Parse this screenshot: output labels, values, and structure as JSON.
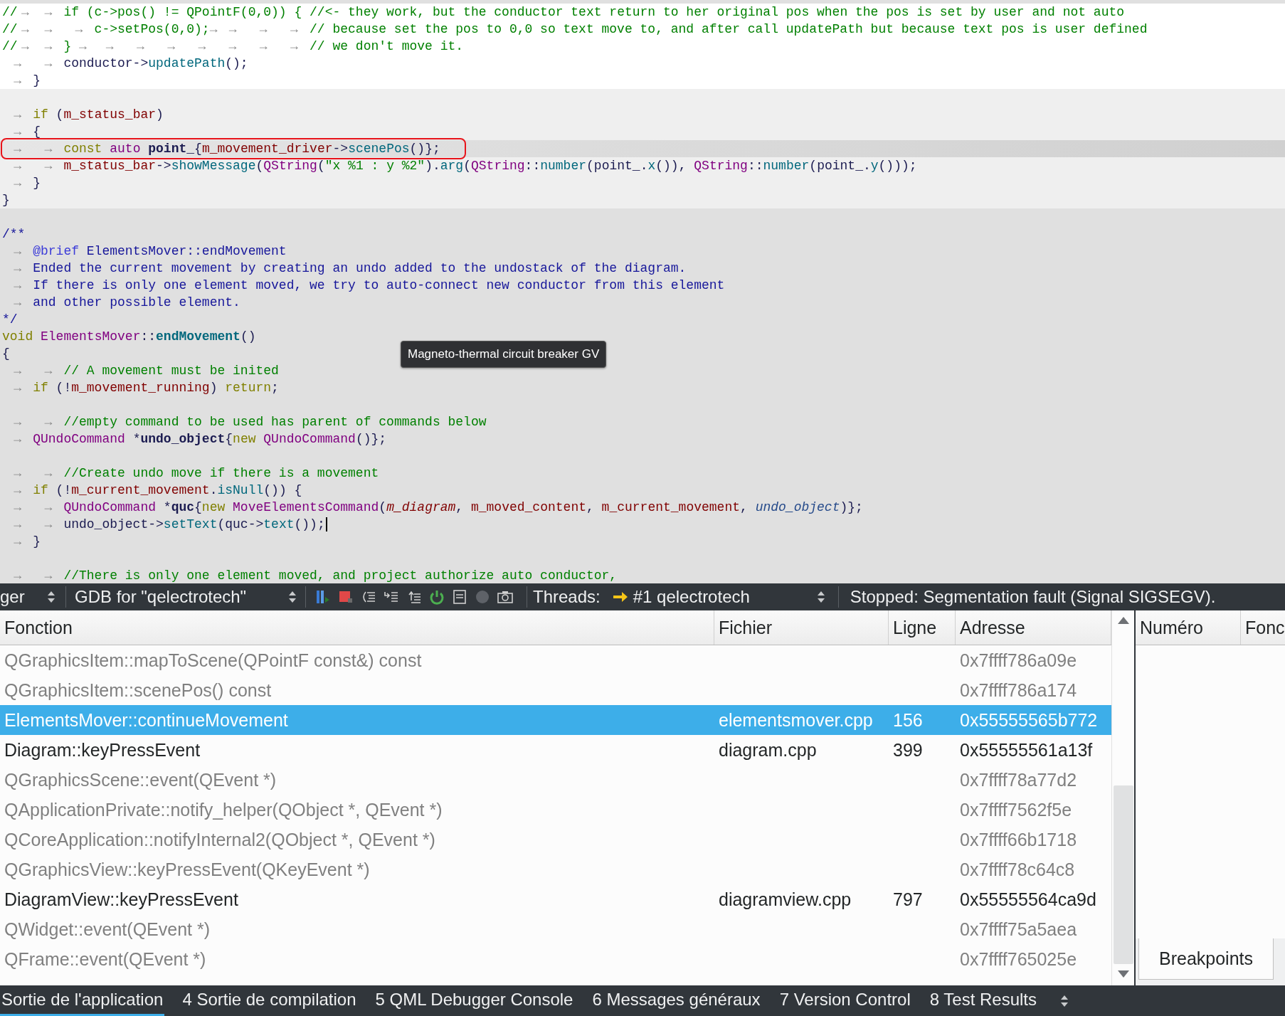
{
  "editor": {
    "blocks": [
      {
        "color": "#ffffff",
        "lines": [
          {
            "tokens": [
              {
                "kind": "comment",
                "text": "//"
              },
              {
                "kind": "tab",
                "text": "→ →"
              },
              {
                "kind": "comment",
                "text": "if (c->pos() != QPointF(0,0)) { //<- they work, but the conductor text return to her original pos when the pos is set by user and not auto"
              }
            ]
          },
          {
            "tokens": [
              {
                "kind": "comment",
                "text": "//"
              },
              {
                "kind": "tab",
                "text": "→ → →"
              },
              {
                "kind": "comment",
                "text": "c->setPos(0,0);"
              },
              {
                "kind": "tab",
                "text": "→ → → →"
              },
              {
                "kind": "comment",
                "text": "// because set the pos to 0,0 so text move to, and after call updatePath but because text pos is user defined"
              }
            ]
          },
          {
            "tokens": [
              {
                "kind": "comment",
                "text": "//"
              },
              {
                "kind": "tab",
                "text": "→ →"
              },
              {
                "kind": "comment",
                "text": "}"
              },
              {
                "kind": "tab",
                "text": "→ → → → → → → →"
              },
              {
                "kind": "comment",
                "text": "// we don't move it."
              }
            ]
          },
          {
            "tokens": [
              {
                "kind": "tab",
                "text": "→ →"
              },
              {
                "kind": "plain",
                "text": "conductor->"
              },
              {
                "kind": "func",
                "text": "updatePath"
              },
              {
                "kind": "plain",
                "text": "();"
              }
            ]
          },
          {
            "tokens": [
              {
                "kind": "tab",
                "text": "→"
              },
              {
                "kind": "plain",
                "text": "}"
              }
            ]
          }
        ]
      },
      {
        "color": "#efefef",
        "lines": [
          {
            "spaced": true,
            "tokens": [
              {
                "kind": "tab",
                "text": "→"
              },
              {
                "kind": "keyword",
                "text": "if"
              },
              {
                "kind": "plain",
                "text": " ("
              },
              {
                "kind": "member",
                "text": "m_status_bar"
              },
              {
                "kind": "plain",
                "text": ")"
              }
            ]
          },
          {
            "tokens": [
              {
                "kind": "tab",
                "text": "→"
              },
              {
                "kind": "plain",
                "text": "{"
              }
            ]
          },
          {
            "current": true,
            "circled": true,
            "tokens": [
              {
                "kind": "tab",
                "text": "→ →"
              },
              {
                "kind": "keyword",
                "text": "const"
              },
              {
                "kind": "type",
                "text": " auto"
              },
              {
                "kind": "decl",
                "text": " point_"
              },
              {
                "kind": "plain",
                "text": "{"
              },
              {
                "kind": "member",
                "text": "m_movement_driver"
              },
              {
                "kind": "plain",
                "text": "->"
              },
              {
                "kind": "func",
                "text": "scenePos"
              },
              {
                "kind": "plain",
                "text": "()};"
              }
            ]
          },
          {
            "tokens": [
              {
                "kind": "tab",
                "text": "→ →"
              },
              {
                "kind": "member",
                "text": "m_status_bar"
              },
              {
                "kind": "plain",
                "text": "->"
              },
              {
                "kind": "func",
                "text": "showMessage"
              },
              {
                "kind": "plain",
                "text": "("
              },
              {
                "kind": "type",
                "text": "QString"
              },
              {
                "kind": "plain",
                "text": "("
              },
              {
                "kind": "string",
                "text": "\"x %1 : y %2\""
              },
              {
                "kind": "plain",
                "text": ")."
              },
              {
                "kind": "func",
                "text": "arg"
              },
              {
                "kind": "plain",
                "text": "("
              },
              {
                "kind": "type",
                "text": "QString"
              },
              {
                "kind": "plain",
                "text": "::"
              },
              {
                "kind": "func",
                "text": "number"
              },
              {
                "kind": "plain",
                "text": "(point_."
              },
              {
                "kind": "func",
                "text": "x"
              },
              {
                "kind": "plain",
                "text": "()), "
              },
              {
                "kind": "type",
                "text": "QString"
              },
              {
                "kind": "plain",
                "text": "::"
              },
              {
                "kind": "func",
                "text": "number"
              },
              {
                "kind": "plain",
                "text": "(point_."
              },
              {
                "kind": "func",
                "text": "y"
              },
              {
                "kind": "plain",
                "text": "()));"
              }
            ]
          },
          {
            "tokens": [
              {
                "kind": "tab",
                "text": "→"
              },
              {
                "kind": "plain",
                "text": "}"
              }
            ]
          },
          {
            "tokens": [
              {
                "kind": "plain",
                "text": "}"
              }
            ]
          }
        ]
      },
      {
        "color": "#e0e0e0",
        "lines": [
          {
            "spaced": true,
            "tokens": [
              {
                "kind": "doc",
                "text": "/**"
              }
            ]
          },
          {
            "tokens": [
              {
                "kind": "tab",
                "text": "→"
              },
              {
                "kind": "doctag",
                "text": "@brief"
              },
              {
                "kind": "doc",
                "text": " ElementsMover::endMovement"
              }
            ]
          },
          {
            "tokens": [
              {
                "kind": "tab",
                "text": "→"
              },
              {
                "kind": "doc",
                "text": "Ended the current movement by creating an undo added to the undostack of the diagram."
              }
            ]
          },
          {
            "tokens": [
              {
                "kind": "tab",
                "text": "→"
              },
              {
                "kind": "doc",
                "text": "If there is only one element moved, we try to auto-connect new conductor from this element"
              }
            ]
          },
          {
            "tokens": [
              {
                "kind": "tab",
                "text": "→"
              },
              {
                "kind": "doc",
                "text": "and other possible element."
              }
            ]
          },
          {
            "tokens": [
              {
                "kind": "doc",
                "text": "*/"
              }
            ]
          },
          {
            "tokens": [
              {
                "kind": "keyword",
                "text": "void"
              },
              {
                "kind": "type",
                "text": " ElementsMover"
              },
              {
                "kind": "plain",
                "text": "::"
              },
              {
                "kind": "declfunc",
                "text": "endMovement"
              },
              {
                "kind": "plain",
                "text": "()"
              }
            ]
          },
          {
            "tokens": [
              {
                "kind": "plain",
                "text": "{"
              }
            ]
          },
          {
            "tokens": [
              {
                "kind": "tab",
                "text": "→ →"
              },
              {
                "kind": "comment",
                "text": "// A movement must be inited"
              }
            ]
          },
          {
            "tokens": [
              {
                "kind": "tab",
                "text": "→"
              },
              {
                "kind": "keyword",
                "text": "if"
              },
              {
                "kind": "plain",
                "text": " (!"
              },
              {
                "kind": "member",
                "text": "m_movement_running"
              },
              {
                "kind": "plain",
                "text": ") "
              },
              {
                "kind": "keyword",
                "text": "return"
              },
              {
                "kind": "plain",
                "text": ";"
              }
            ]
          },
          {
            "spaced": true,
            "tokens": [
              {
                "kind": "tab",
                "text": "→ →"
              },
              {
                "kind": "comment",
                "text": "//empty command to be used has parent of commands below"
              }
            ]
          },
          {
            "tokens": [
              {
                "kind": "tab",
                "text": "→"
              },
              {
                "kind": "type",
                "text": "QUndoCommand"
              },
              {
                "kind": "plain",
                "text": " *"
              },
              {
                "kind": "decl",
                "text": "undo_object"
              },
              {
                "kind": "plain",
                "text": "{"
              },
              {
                "kind": "keyword",
                "text": "new"
              },
              {
                "kind": "type",
                "text": " QUndoCommand"
              },
              {
                "kind": "plain",
                "text": "()};"
              }
            ]
          },
          {
            "spaced": true,
            "tokens": [
              {
                "kind": "tab",
                "text": "→ →"
              },
              {
                "kind": "comment",
                "text": "//Create undo move if there is a movement"
              }
            ]
          },
          {
            "tokens": [
              {
                "kind": "tab",
                "text": "→"
              },
              {
                "kind": "keyword",
                "text": "if"
              },
              {
                "kind": "plain",
                "text": " (!"
              },
              {
                "kind": "member",
                "text": "m_current_movement"
              },
              {
                "kind": "plain",
                "text": "."
              },
              {
                "kind": "func",
                "text": "isNull"
              },
              {
                "kind": "plain",
                "text": "()) {"
              }
            ]
          },
          {
            "tokens": [
              {
                "kind": "tab",
                "text": "→ →"
              },
              {
                "kind": "type",
                "text": "QUndoCommand"
              },
              {
                "kind": "plain",
                "text": " *"
              },
              {
                "kind": "decl",
                "text": "quc"
              },
              {
                "kind": "plain",
                "text": "{"
              },
              {
                "kind": "keyword",
                "text": "new"
              },
              {
                "kind": "type",
                "text": " MoveElementsCommand"
              },
              {
                "kind": "plain",
                "text": "("
              },
              {
                "kind": "parammember",
                "text": "m_diagram"
              },
              {
                "kind": "plain",
                "text": ", "
              },
              {
                "kind": "member",
                "text": "m_moved_content"
              },
              {
                "kind": "plain",
                "text": ", "
              },
              {
                "kind": "member",
                "text": "m_current_movement"
              },
              {
                "kind": "plain",
                "text": ", "
              },
              {
                "kind": "param",
                "text": "undo_object"
              },
              {
                "kind": "plain",
                "text": ")};"
              }
            ]
          },
          {
            "cursor": true,
            "tokens": [
              {
                "kind": "tab",
                "text": "→ →"
              },
              {
                "kind": "plain",
                "text": "undo_object->"
              },
              {
                "kind": "func",
                "text": "setText"
              },
              {
                "kind": "plain",
                "text": "(quc->"
              },
              {
                "kind": "func",
                "text": "text"
              },
              {
                "kind": "plain",
                "text": "());"
              }
            ]
          },
          {
            "tokens": [
              {
                "kind": "tab",
                "text": "→"
              },
              {
                "kind": "plain",
                "text": "}"
              }
            ]
          },
          {
            "spaced": true,
            "tokens": [
              {
                "kind": "tab",
                "text": "→ →"
              },
              {
                "kind": "comment",
                "text": "//There is only one element moved, and project authorize auto conductor,"
              }
            ]
          }
        ]
      }
    ],
    "tooltip": "Magneto-thermal circuit breaker GV"
  },
  "debug_toolbar": {
    "perspective": "ger",
    "engine": "GDB for \"qelectrotech\"",
    "threads_label": "Threads:",
    "thread": "#1 qelectrotech",
    "status": "Stopped: Segmentation fault (Signal SIGSEGV)."
  },
  "stack": {
    "columns": [
      "Fonction",
      "Fichier",
      "Ligne",
      "Adresse"
    ],
    "rows": [
      {
        "function": "QGraphicsItem::mapToScene(QPointF const&) const",
        "address": "0x7ffff786a09e",
        "dimmed": true,
        "selected": false
      },
      {
        "function": "QGraphicsItem::scenePos() const",
        "address": "0x7ffff786a174",
        "dimmed": true,
        "selected": false
      },
      {
        "function": "ElementsMover::continueMovement",
        "file": "elementsmover.cpp",
        "line": "156",
        "address": "0x55555565b772",
        "dimmed": false,
        "selected": true
      },
      {
        "function": "Diagram::keyPressEvent",
        "file": "diagram.cpp",
        "line": "399",
        "address": "0x55555561a13f",
        "dimmed": false,
        "selected": false
      },
      {
        "function": "QGraphicsScene::event(QEvent *)",
        "address": "0x7ffff78a77d2",
        "dimmed": true,
        "selected": false
      },
      {
        "function": "QApplicationPrivate::notify_helper(QObject *, QEvent *)",
        "address": "0x7ffff7562f5e",
        "dimmed": true,
        "selected": false
      },
      {
        "function": "QCoreApplication::notifyInternal2(QObject *, QEvent *)",
        "address": "0x7ffff66b1718",
        "dimmed": true,
        "selected": false
      },
      {
        "function": "QGraphicsView::keyPressEvent(QKeyEvent *)",
        "address": "0x7ffff78c64c8",
        "dimmed": true,
        "selected": false
      },
      {
        "function": "DiagramView::keyPressEvent",
        "file": "diagramview.cpp",
        "line": "797",
        "address": "0x55555564ca9d",
        "dimmed": false,
        "selected": false
      },
      {
        "function": "QWidget::event(QEvent *)",
        "address": "0x7ffff75a5aea",
        "dimmed": true,
        "selected": false
      },
      {
        "function": "QFrame::event(QEvent *)",
        "address": "0x7ffff765025e",
        "dimmed": true,
        "selected": false
      }
    ]
  },
  "breakpoints": {
    "columns": [
      "Numéro",
      "Fonc"
    ],
    "tab": "Breakpoints"
  },
  "output_tabs": [
    {
      "label": "Sortie de l'application",
      "selected": true
    },
    {
      "label": "4 Sortie de compilation",
      "selected": false
    },
    {
      "label": "5 QML Debugger Console",
      "selected": false
    },
    {
      "label": "6 Messages généraux",
      "selected": false
    },
    {
      "label": "7 Version Control",
      "selected": false
    },
    {
      "label": "8 Test Results",
      "selected": false
    }
  ]
}
